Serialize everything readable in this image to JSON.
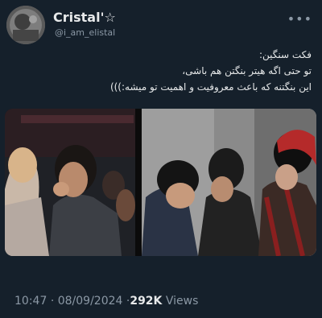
{
  "user": {
    "display_name": "Cristal'☆",
    "handle": "@i_am_elistal"
  },
  "more_icon": "more-horizontal-icon",
  "tweet": {
    "lines": [
      "فکت سنگین:",
      "تو حتی اگه هیتر بنگتن هم باشی،",
      "این بنگتنه که باعث معروفیت و اهمیت تو میشه:)))"
    ]
  },
  "meta": {
    "time": "10:47",
    "date": "08/09/2024",
    "sep": "·",
    "views_count": "292K",
    "views_label": "Views"
  }
}
